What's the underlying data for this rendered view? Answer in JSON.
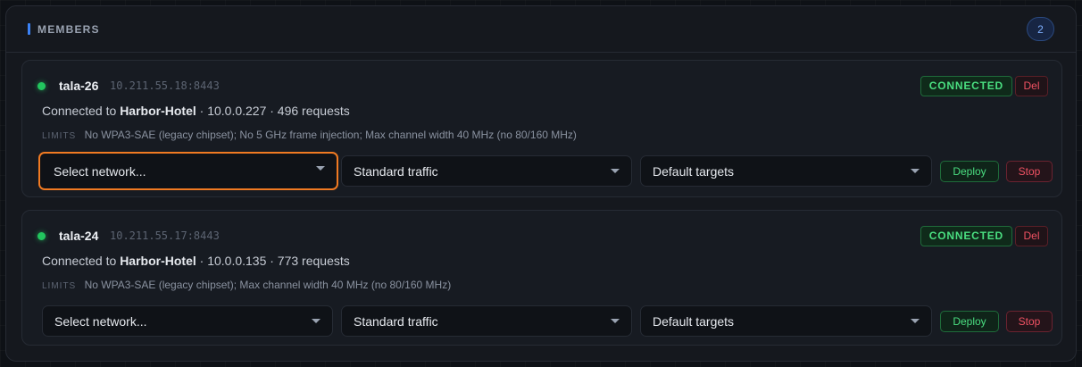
{
  "panel": {
    "title": "MEMBERS",
    "count": "2"
  },
  "members": [
    {
      "name": "tala-26",
      "address": "10.211.55.18:8443",
      "state": "CONNECTED",
      "del_label": "Del",
      "connected_prefix": "Connected to",
      "network": "Harbor-Hotel",
      "connection_details": "· 10.0.0.227 · 496 requests",
      "limits_label": "LIMITS",
      "limits": "No WPA3-SAE (legacy chipset); No 5 GHz frame injection; Max channel width 40 MHz (no 80/160 MHz)",
      "network_select": "Select network...",
      "traffic_select": "Standard traffic",
      "targets_select": "Default targets",
      "deploy_label": "Deploy",
      "stop_label": "Stop"
    },
    {
      "name": "tala-24",
      "address": "10.211.55.17:8443",
      "state": "CONNECTED",
      "del_label": "Del",
      "connected_prefix": "Connected to",
      "network": "Harbor-Hotel",
      "connection_details": "· 10.0.0.135 · 773 requests",
      "limits_label": "LIMITS",
      "limits": "No WPA3-SAE (legacy chipset); Max channel width 40 MHz (no 80/160 MHz)",
      "network_select": "Select network...",
      "traffic_select": "Standard traffic",
      "targets_select": "Default targets",
      "deploy_label": "Deploy",
      "stop_label": "Stop"
    }
  ],
  "colors": {
    "accent": "#3b82f6",
    "connected": "#4ade80",
    "danger": "#f05263",
    "focus": "#f07a22"
  }
}
